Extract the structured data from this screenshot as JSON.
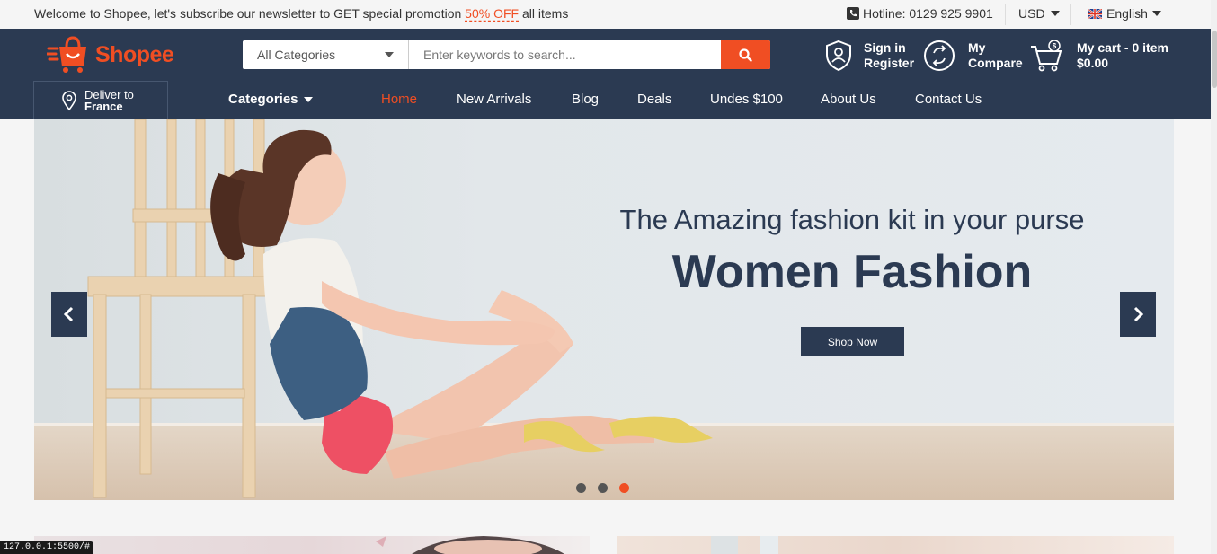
{
  "topbar": {
    "welcome_text": "Welcome to Shopee, let's subscribe our newsletter to GET special promotion",
    "promo_text": "50% OFF",
    "promo_suffix": "all items",
    "hotline": "Hotline: 0129 925 9901",
    "currency": "USD",
    "language": "English"
  },
  "header": {
    "logo_text": "Shopee",
    "search": {
      "category": "All Categories",
      "placeholder": "Enter keywords to search..."
    },
    "account": {
      "line1": "Sign in",
      "line2": "Register"
    },
    "compare": {
      "line1": "My",
      "line2": "Compare"
    },
    "cart": {
      "line1": "My cart - 0 item",
      "line2": "$0.00"
    },
    "deliver": {
      "line1": "Deliver to",
      "line2": "France"
    }
  },
  "nav": {
    "categories": "Categories",
    "items": [
      "Home",
      "New Arrivals",
      "Blog",
      "Deals",
      "Undes $100",
      "About Us",
      "Contact Us"
    ],
    "active_index": 0
  },
  "hero": {
    "subtitle": "The Amazing fashion kit in your purse",
    "title": "Women Fashion",
    "button": "Shop Now",
    "slides_count": 3,
    "active_slide": 3
  },
  "status_bar": "127.0.0.1:5500/#",
  "colors": {
    "accent": "#f04e23",
    "navy": "#2b3a52"
  },
  "icons": [
    "phone-icon",
    "uk-flag-icon",
    "shopping-bag-logo-icon",
    "search-icon",
    "user-shield-icon",
    "compare-icon",
    "cart-icon",
    "location-pin-icon",
    "chevron-left-icon",
    "chevron-right-icon"
  ]
}
